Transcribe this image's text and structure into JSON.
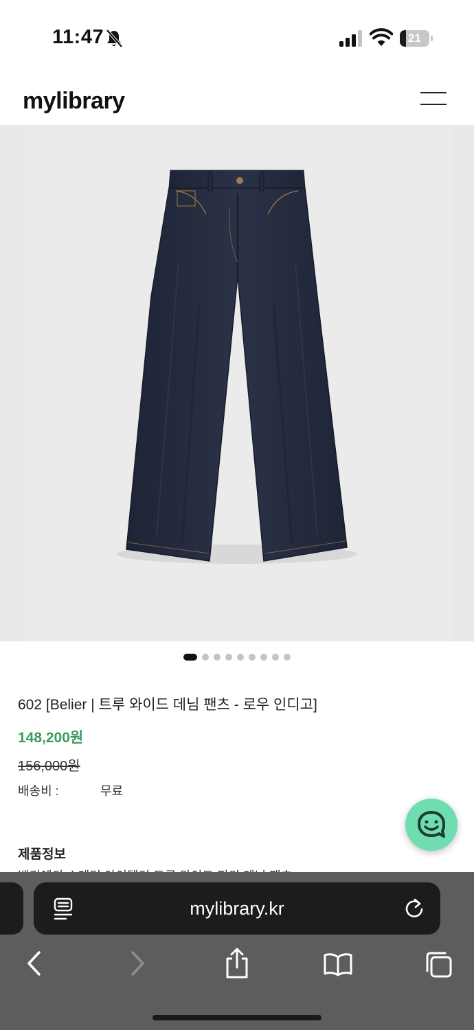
{
  "status_bar": {
    "time": "11:47",
    "battery_level": "21",
    "battery_fraction": 0.21,
    "icons": [
      "bell-slash-icon",
      "signal-icon",
      "wifi-icon",
      "battery-icon"
    ]
  },
  "header": {
    "logo": "mylibrary",
    "menu_icon": "hamburger-menu-icon"
  },
  "gallery": {
    "image": "navy wide denim pants",
    "slide_count": 9,
    "active_slide": 1
  },
  "product": {
    "name": "602 [Belier | 트루 와이드 데님 팬츠 - 로우 인디고]",
    "sale_price": "148,200원",
    "original_price": "156,000원",
    "shipping_label": "배송비 :",
    "shipping_value": "무료",
    "info_heading": "제품정보",
    "info_text_partial": "벨리에의 스테디 아이템인 트루 와이드 핏의 데님 팬츠"
  },
  "chat_button": {
    "icon": "chat-bubble-icon",
    "color": "#6fddb0"
  },
  "browser": {
    "url": "mylibrary.kr",
    "icons": [
      "reader-icon",
      "reload-icon",
      "back-icon",
      "forward-icon",
      "share-icon",
      "bookmarks-icon",
      "tabs-icon"
    ]
  },
  "colors": {
    "sale_price": "#3d9a5c",
    "denim": "#262c40",
    "gallery_bg": "#e9e9e9",
    "toolbar_bg": "#5d5d5d"
  }
}
